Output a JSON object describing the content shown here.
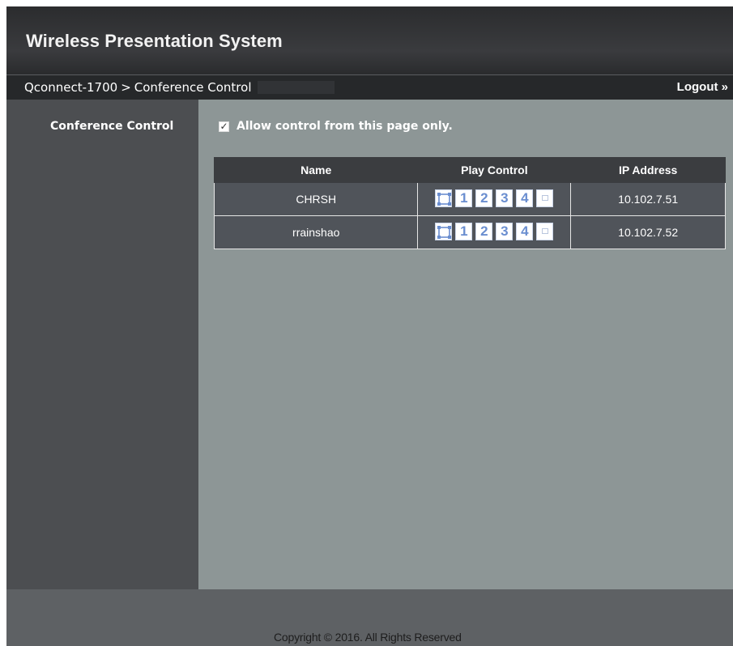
{
  "header": {
    "title": "Wireless Presentation System"
  },
  "nav": {
    "breadcrumb": {
      "device": "Qconnect-1700",
      "separator": ">",
      "page": "Conference Control"
    },
    "logout_label": "Logout »"
  },
  "sidebar": {
    "items": [
      {
        "label": "Conference Control"
      }
    ]
  },
  "main": {
    "allow_control": {
      "checked": true,
      "label": "Allow control from this page only."
    },
    "table": {
      "headers": [
        "Name",
        "Play Control",
        "IP Address"
      ],
      "rows": [
        {
          "name": "CHRSH",
          "ip": "10.102.7.51"
        },
        {
          "name": "rrainshao",
          "ip": "10.102.7.52"
        }
      ],
      "play_buttons": [
        "1",
        "2",
        "3",
        "4"
      ]
    }
  },
  "footer": {
    "copyright": "Copyright © 2016. All Rights Reserved"
  },
  "icons": {
    "fullscreen": "fullscreen-icon",
    "stop": "stop-icon",
    "check": "checkmark-icon"
  },
  "colors": {
    "header_bg": "#2f3033",
    "sidebar_bg": "#4c4e51",
    "content_bg": "#8d9696",
    "play_button_text": "#6a8ed0"
  }
}
